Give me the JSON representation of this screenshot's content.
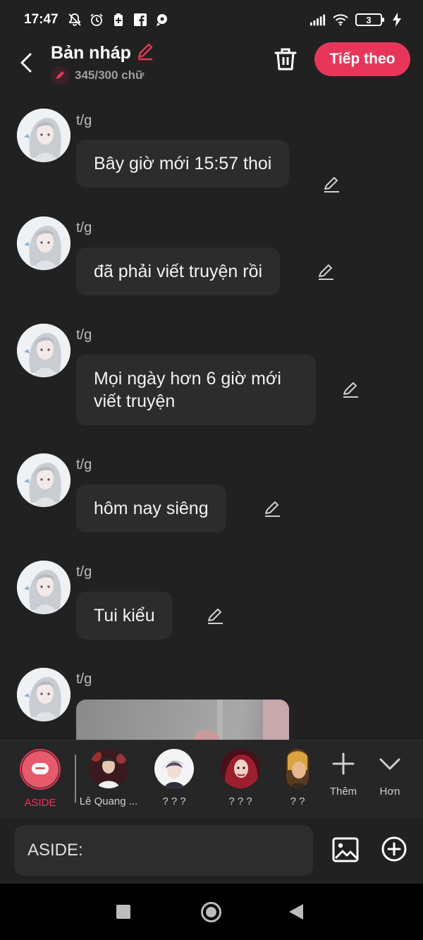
{
  "status_bar": {
    "time": "17:47",
    "battery_level": "3",
    "icons": [
      "mute-bell-icon",
      "alarm-icon",
      "battery-saver-icon",
      "facebook-icon",
      "chat-icon",
      "signal-icon",
      "wifi-icon",
      "charging-icon"
    ]
  },
  "header": {
    "title": "Bản nháp",
    "word_count": "345/300 chữ",
    "next_label": "Tiếp theo",
    "accent_color": "#e8365a"
  },
  "messages": [
    {
      "sender": "t/g",
      "text": "Bây giờ mới 15:57 thoi"
    },
    {
      "sender": "t/g",
      "text": "đã phải viết truyện rồi"
    },
    {
      "sender": "t/g",
      "text": "Mọi ngày hơn 6 giờ mới viết truyện"
    },
    {
      "sender": "t/g",
      "text": "hôm nay siêng"
    },
    {
      "sender": "t/g",
      "text": "Tui kiểu"
    },
    {
      "sender": "t/g",
      "text": ""
    }
  ],
  "characters": [
    {
      "label": "ASIDE",
      "selected": true
    },
    {
      "label": "Lê Quang ..."
    },
    {
      "label": "? ? ?"
    },
    {
      "label": "?  ?  ?"
    },
    {
      "label": "?  ?"
    }
  ],
  "actions": {
    "more_label": "Thêm",
    "expand_label": "Hơn"
  },
  "input": {
    "placeholder": "ASIDE:"
  }
}
